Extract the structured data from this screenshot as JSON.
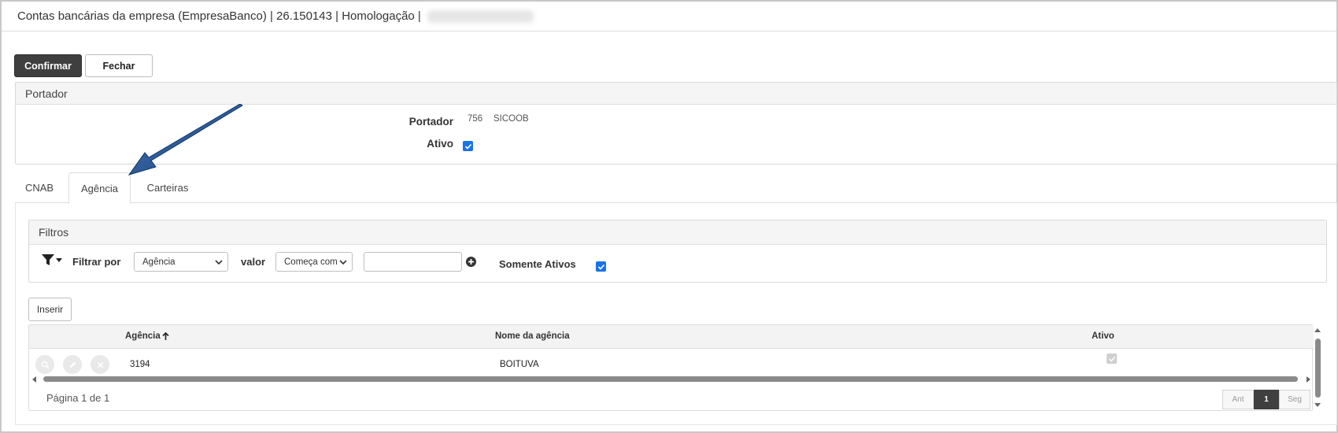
{
  "window": {
    "title": "Contas bancárias da empresa (EmpresaBanco) | 26.150143 | Homologação |"
  },
  "toolbar": {
    "confirm_label": "Confirmar",
    "close_label": "Fechar"
  },
  "portador_panel": {
    "title": "Portador",
    "portador_label": "Portador",
    "portador_code": "756",
    "portador_name": "SICOOB",
    "ativo_label": "Ativo",
    "ativo_checked": true
  },
  "tabs": [
    {
      "label": "CNAB",
      "active": false
    },
    {
      "label": "Agência",
      "active": true
    },
    {
      "label": "Carteiras",
      "active": false
    }
  ],
  "filters": {
    "title": "Filtros",
    "filter_by_label": "Filtrar por",
    "filter_field_selected": "Agência",
    "value_label": "valor",
    "operator_selected": "Começa com",
    "value_input": "",
    "only_active_label": "Somente Ativos",
    "only_active_checked": true
  },
  "grid": {
    "insert_label": "Inserir",
    "columns": [
      "Agência",
      "Nome da agência",
      "Ativo"
    ],
    "sort_icon": "arrow-up-icon",
    "rows": [
      {
        "agencia": "3194",
        "nome": "BOITUVA",
        "ativo": true
      }
    ],
    "page_info": "Página 1 de 1",
    "pager": {
      "prev": "Ant",
      "current": "1",
      "next": "Seg"
    }
  },
  "colors": {
    "primary_button": "#3f3f3f",
    "checkbox": "#1a73e8",
    "annotation_arrow": "#1f4e8c"
  }
}
